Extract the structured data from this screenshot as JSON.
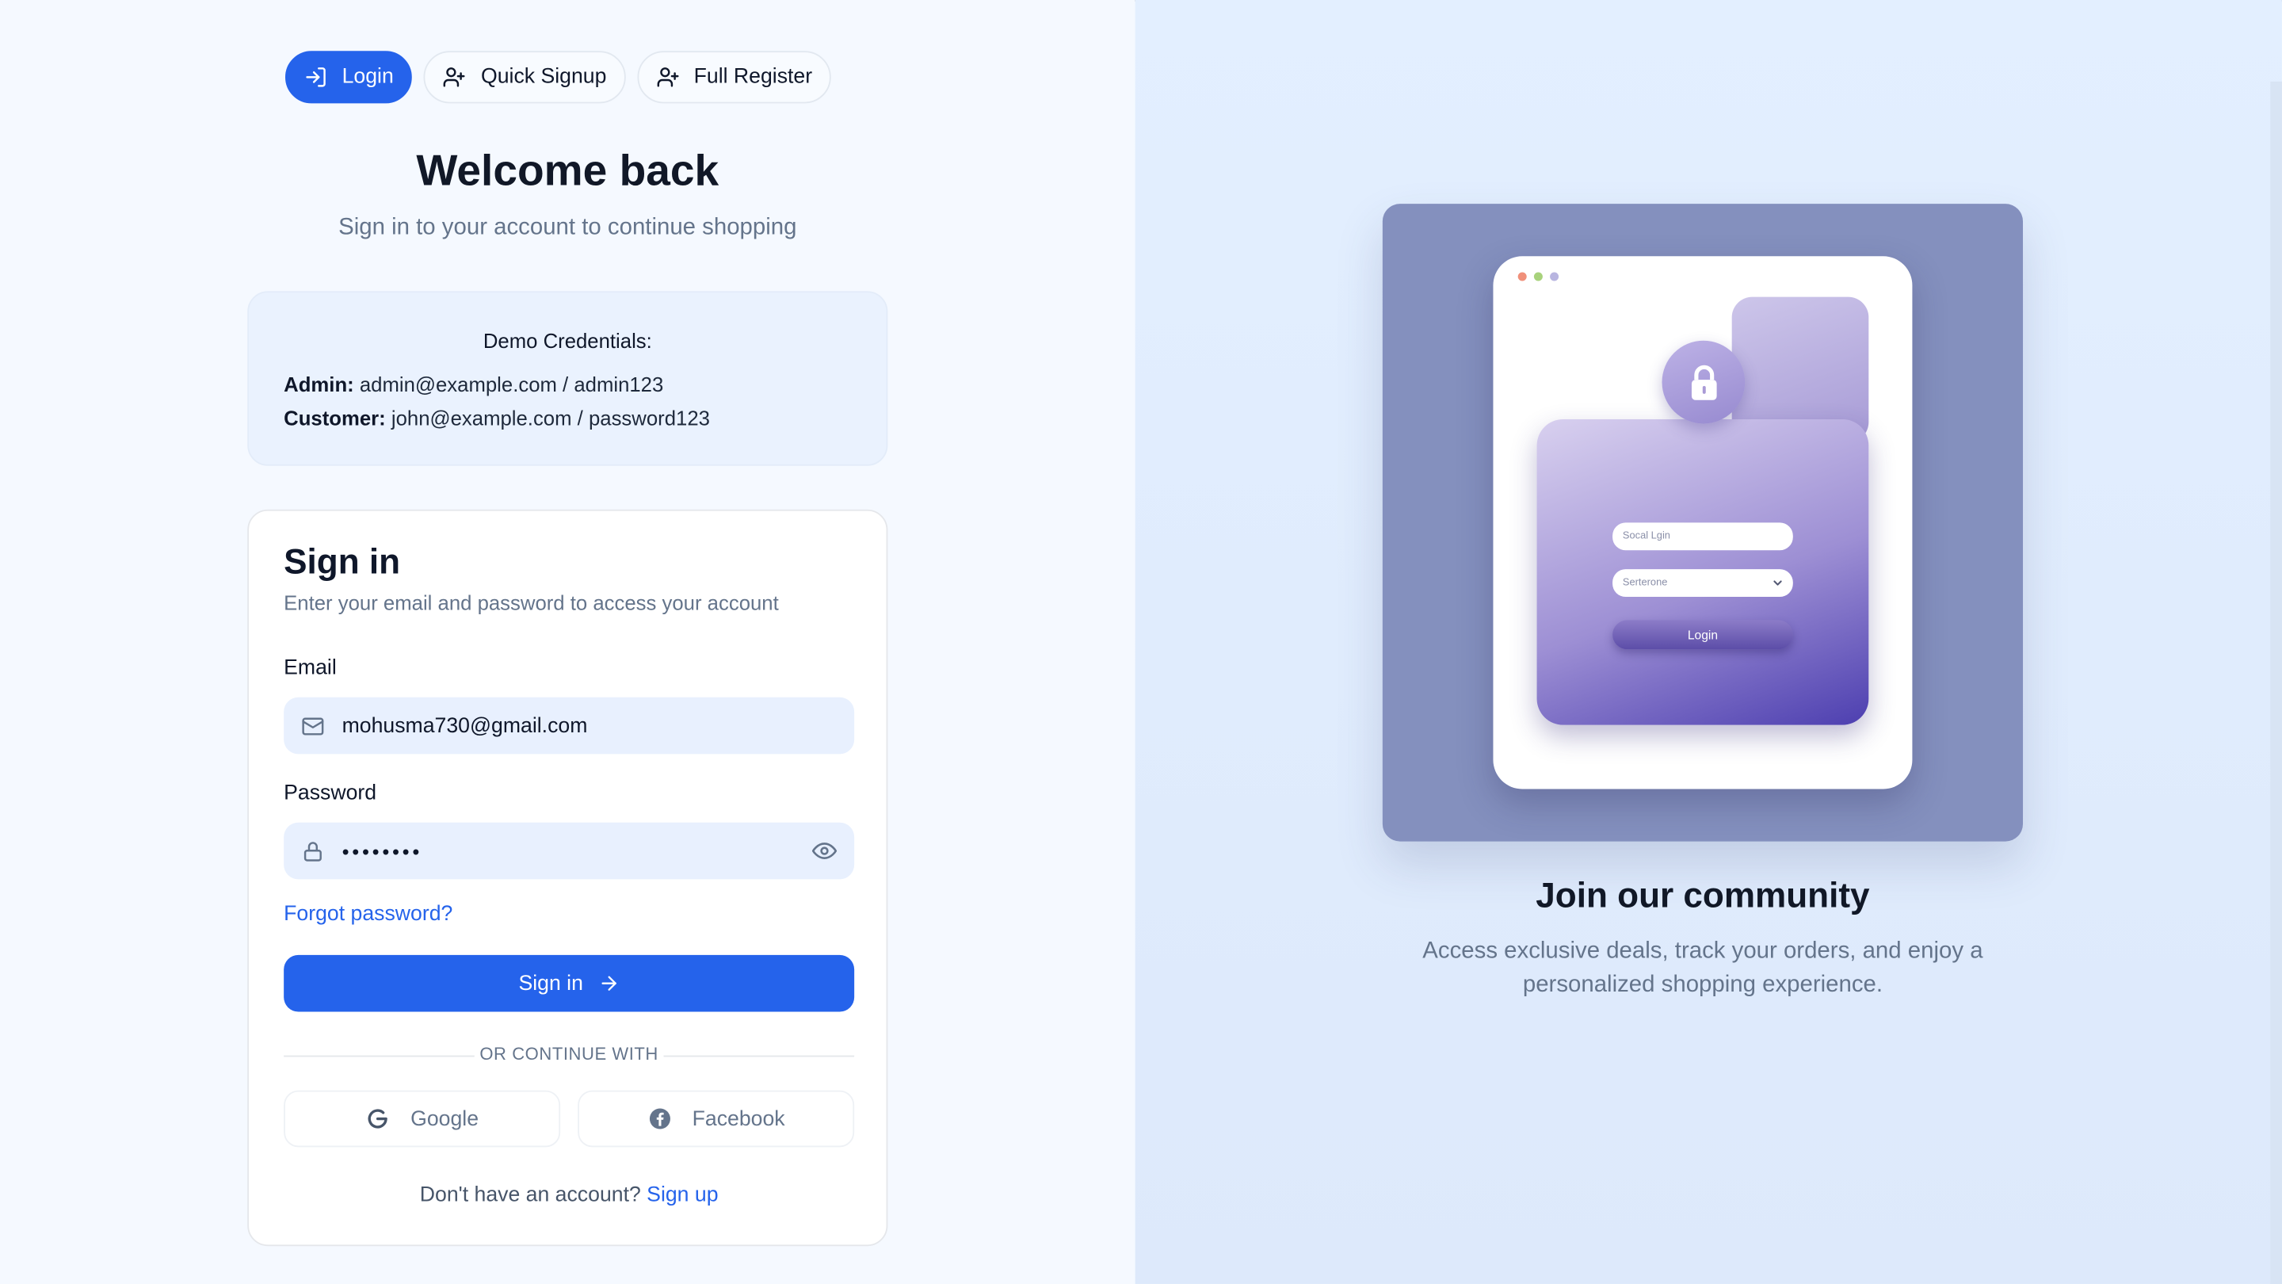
{
  "tabs": [
    {
      "label": "Login",
      "icon": "login-icon",
      "active": true
    },
    {
      "label": "Quick Signup",
      "icon": "user-plus-icon",
      "active": false
    },
    {
      "label": "Full Register",
      "icon": "user-plus-icon",
      "active": false
    }
  ],
  "hero": {
    "title": "Welcome back",
    "subtitle": "Sign in to your account to continue shopping"
  },
  "demo": {
    "title": "Demo Credentials:",
    "admin_label": "Admin:",
    "admin_value": "admin@example.com / admin123",
    "customer_label": "Customer:",
    "customer_value": "john@example.com / password123"
  },
  "signin": {
    "title": "Sign in",
    "subtitle": "Enter your email and password to access your account",
    "email_label": "Email",
    "email_value": "mohusma730@gmail.com",
    "password_label": "Password",
    "password_masked": "••••••••",
    "forgot": "Forgot password?",
    "button": "Sign in",
    "divider": "OR CONTINUE WITH",
    "google": "Google",
    "facebook": "Facebook",
    "no_account": "Don't have an account?",
    "signup_link": "Sign up"
  },
  "illustration": {
    "input1": "Socal Lgin",
    "input2": "Serterone",
    "button": "Login"
  },
  "community": {
    "title": "Join our community",
    "subtitle": "Access exclusive deals, track your orders, and enjoy a personalized shopping experience."
  },
  "colors": {
    "primary": "#2563eb",
    "left_bg": "#f5f9ff",
    "right_bg": "#e3efff",
    "illustration_bg": "#8490be"
  }
}
